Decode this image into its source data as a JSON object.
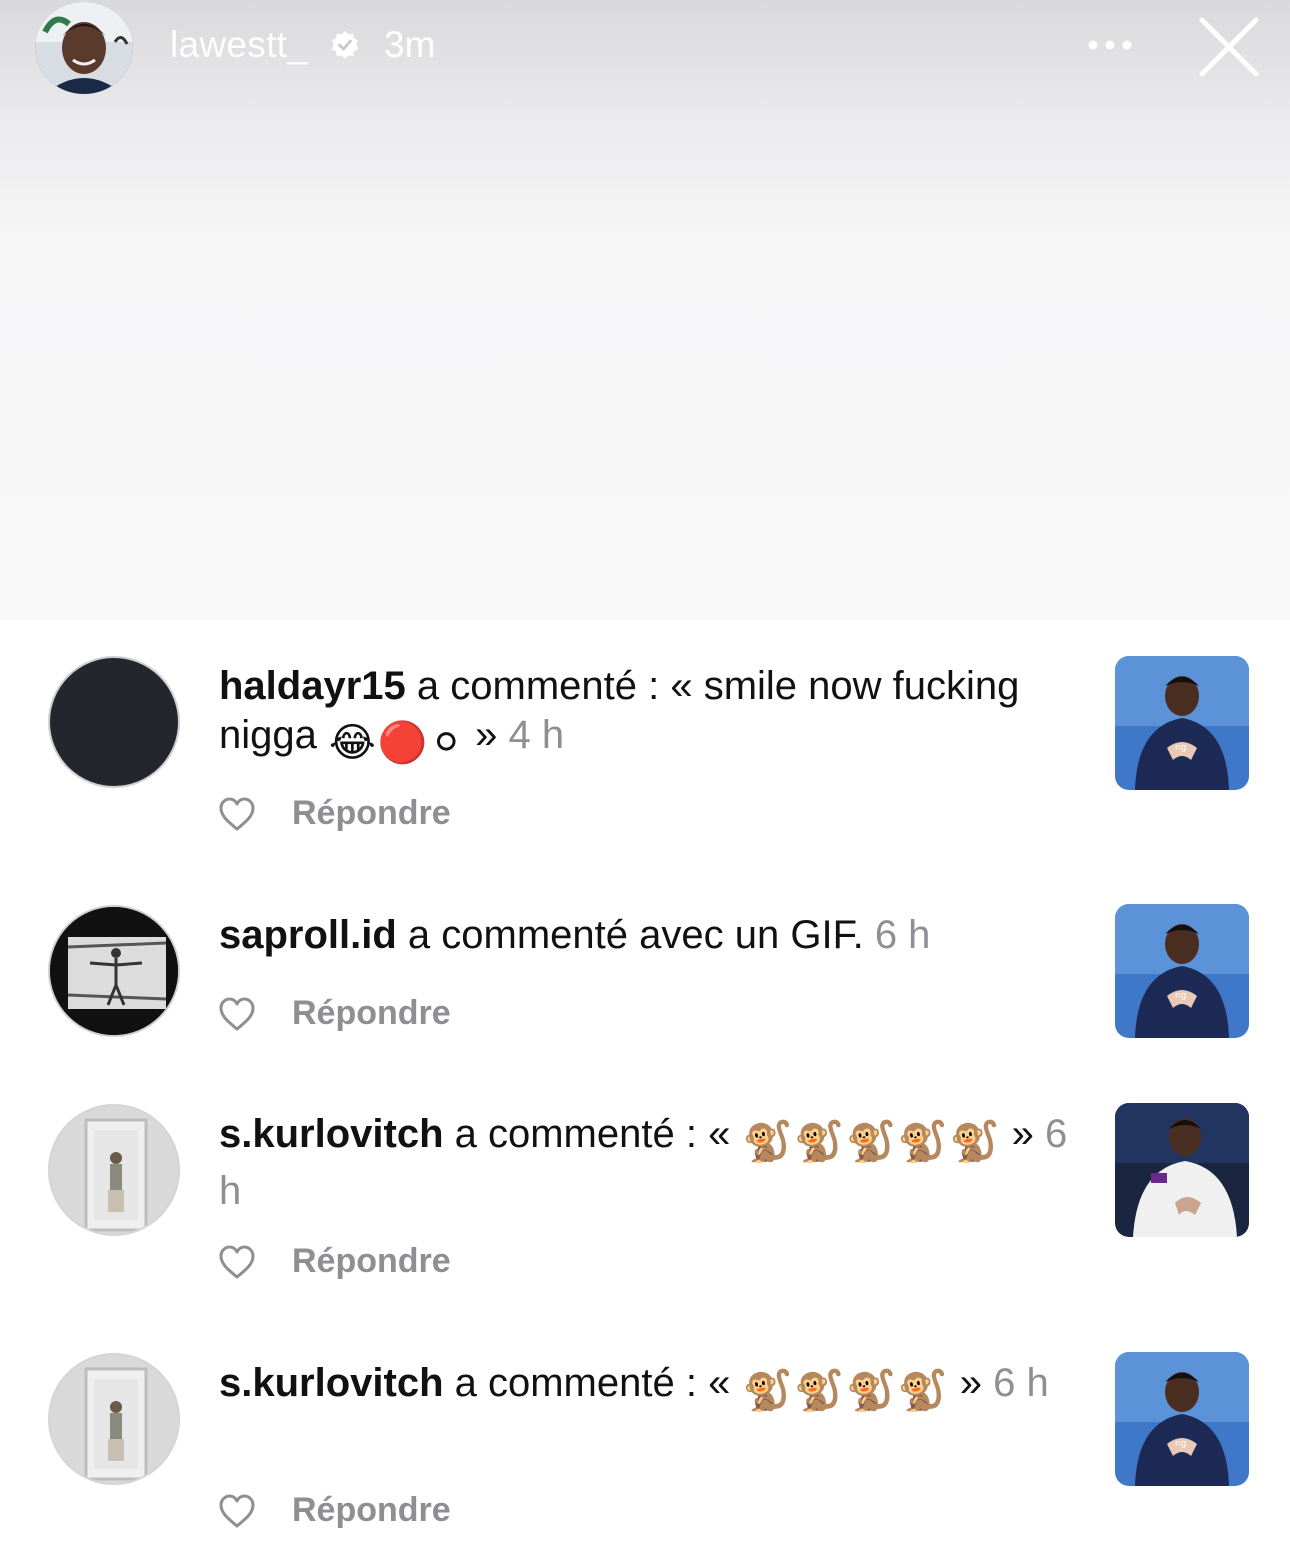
{
  "story": {
    "username": "lawestt_",
    "time": "3m",
    "verified_icon": "verified-badge-icon",
    "more_icon": "more-dots-icon",
    "close_icon": "close-icon"
  },
  "comments": [
    {
      "username": "haldayr15",
      "text": " a commenté : « smile now fucking nigga ",
      "emojis": [
        "😂",
        "🔴",
        "⚪"
      ],
      "after": " » ",
      "time": "4 h",
      "reply_label": "Répondre"
    },
    {
      "username": "saproll.id",
      "text": " a commenté avec un GIF. ",
      "emojis": [],
      "after": "",
      "time": "6 h",
      "reply_label": "Répondre"
    },
    {
      "username": "s.kurlovitch",
      "text": " a commenté : « ",
      "emojis": [
        "🐒",
        "🐒",
        "🐒",
        "🐒",
        "🐒"
      ],
      "after": " » ",
      "time": "6 h",
      "reply_label": "Répondre"
    },
    {
      "username": "s.kurlovitch",
      "text": " a commenté : « ",
      "emojis": [
        "🐒",
        "🐒",
        "🐒",
        "🐒"
      ],
      "after": " » ",
      "time": "6 h",
      "reply_label": "Répondre"
    }
  ],
  "colors": {
    "secondary_text": "#8e8e93",
    "primary_text": "#111111"
  }
}
